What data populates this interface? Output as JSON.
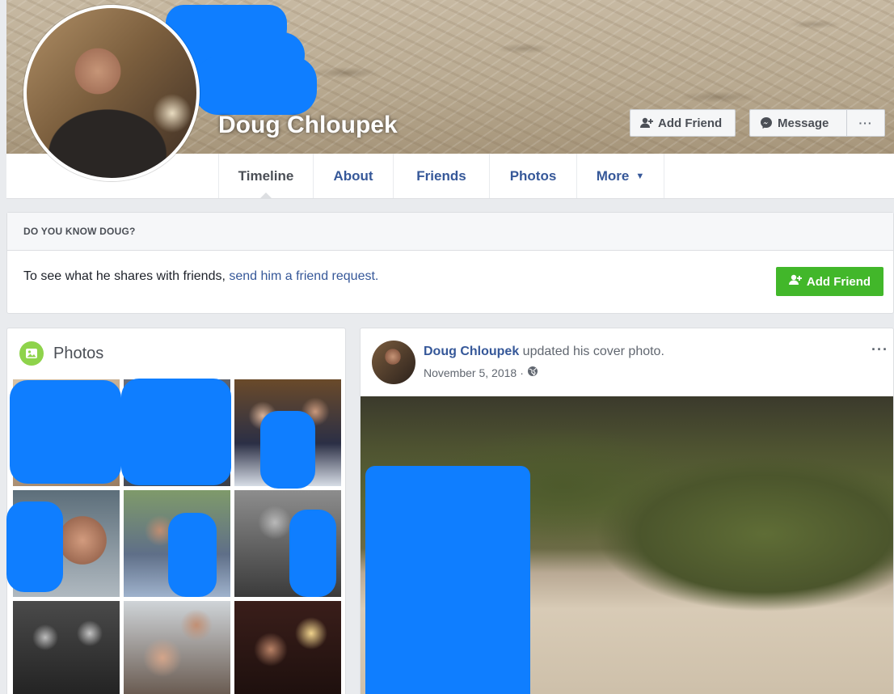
{
  "profile": {
    "name": "Doug Chloupek"
  },
  "cover_actions": {
    "add_friend": "Add Friend",
    "message": "Message",
    "more": "···"
  },
  "nav": {
    "tabs": [
      {
        "label": "Timeline"
      },
      {
        "label": "About"
      },
      {
        "label": "Friends"
      },
      {
        "label": "Photos"
      },
      {
        "label": "More"
      }
    ]
  },
  "know_box": {
    "heading": "DO YOU KNOW DOUG?",
    "text": "To see what he shares with friends, ",
    "link": "send him a friend request.",
    "button": "Add Friend"
  },
  "photos_card": {
    "title": "Photos"
  },
  "post": {
    "author": "Doug Chloupek",
    "action": " updated his cover photo.",
    "date": "November 5, 2018",
    "separator": "·",
    "menu": "···"
  },
  "colors": {
    "link_blue": "#365899",
    "green_button": "#42b72a",
    "redaction_blue": "#0f7eff",
    "page_bg": "#e9ebee"
  },
  "icons": {
    "add_friend": "add-friend-icon",
    "message": "messenger-icon",
    "photos": "photos-icon",
    "privacy": "globe-icon",
    "caret": "caret-down-icon"
  }
}
